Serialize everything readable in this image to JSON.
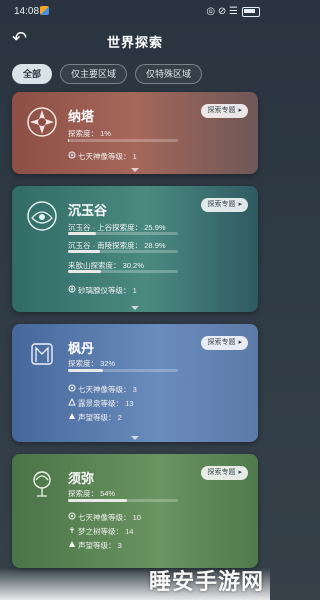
{
  "status": {
    "time": "14:08",
    "right": "◎ ⊘ ☰"
  },
  "header": {
    "title": "世界探索",
    "back_icon": "back-arrow-icon"
  },
  "filters": [
    {
      "label": "全部",
      "active": true
    },
    {
      "label": "仅主要区域",
      "active": false
    },
    {
      "label": "仅特殊区域",
      "active": false
    }
  ],
  "cards": [
    {
      "name": "纳塔",
      "special_label": "探索专题",
      "color": "#9a5a4d",
      "rows": [
        {
          "label": "探索度：",
          "value": "1%",
          "progress": 0.01
        }
      ],
      "stats": [
        {
          "icon": "statue-icon",
          "label": "七天神像等级：",
          "value": "1"
        }
      ]
    },
    {
      "name": "沉玉谷",
      "special_label": "探索专题",
      "color": "#3e7b73",
      "rows": [
        {
          "label": "沉玉谷 · 上谷探索度：",
          "value": "25.9%",
          "progress": 0.259
        },
        {
          "label": "沉玉谷 · 南陵探索度：",
          "value": "28.9%",
          "progress": 0.289
        },
        {
          "label": "来歆山探索度：",
          "value": "30.2%",
          "progress": 0.302
        }
      ],
      "stats": [
        {
          "icon": "tree-icon",
          "label": "砂璃腺仪等级：",
          "value": "1"
        }
      ]
    },
    {
      "name": "枫丹",
      "special_label": "探索专题",
      "color": "#4d6b98",
      "rows": [
        {
          "label": "探索度：",
          "value": "32%",
          "progress": 0.32
        }
      ],
      "stats": [
        {
          "icon": "statue-icon",
          "label": "七天神像等级：",
          "value": "3"
        },
        {
          "icon": "mountain-icon",
          "label": "露景泉等级：",
          "value": "13"
        },
        {
          "icon": "reputation-icon",
          "label": "声望等级：",
          "value": "2"
        }
      ]
    },
    {
      "name": "须弥",
      "special_label": "探索专题",
      "color": "#4f7a4c",
      "rows": [
        {
          "label": "探索度：",
          "value": "54%",
          "progress": 0.54
        }
      ],
      "stats": [
        {
          "icon": "statue-icon",
          "label": "七天神像等级：",
          "value": "10"
        },
        {
          "icon": "dream-tree-icon",
          "label": "梦之树等级：",
          "value": "14"
        },
        {
          "icon": "reputation-icon",
          "label": "声望等级：",
          "value": "3"
        }
      ]
    }
  ],
  "watermark": "睡安手游网"
}
